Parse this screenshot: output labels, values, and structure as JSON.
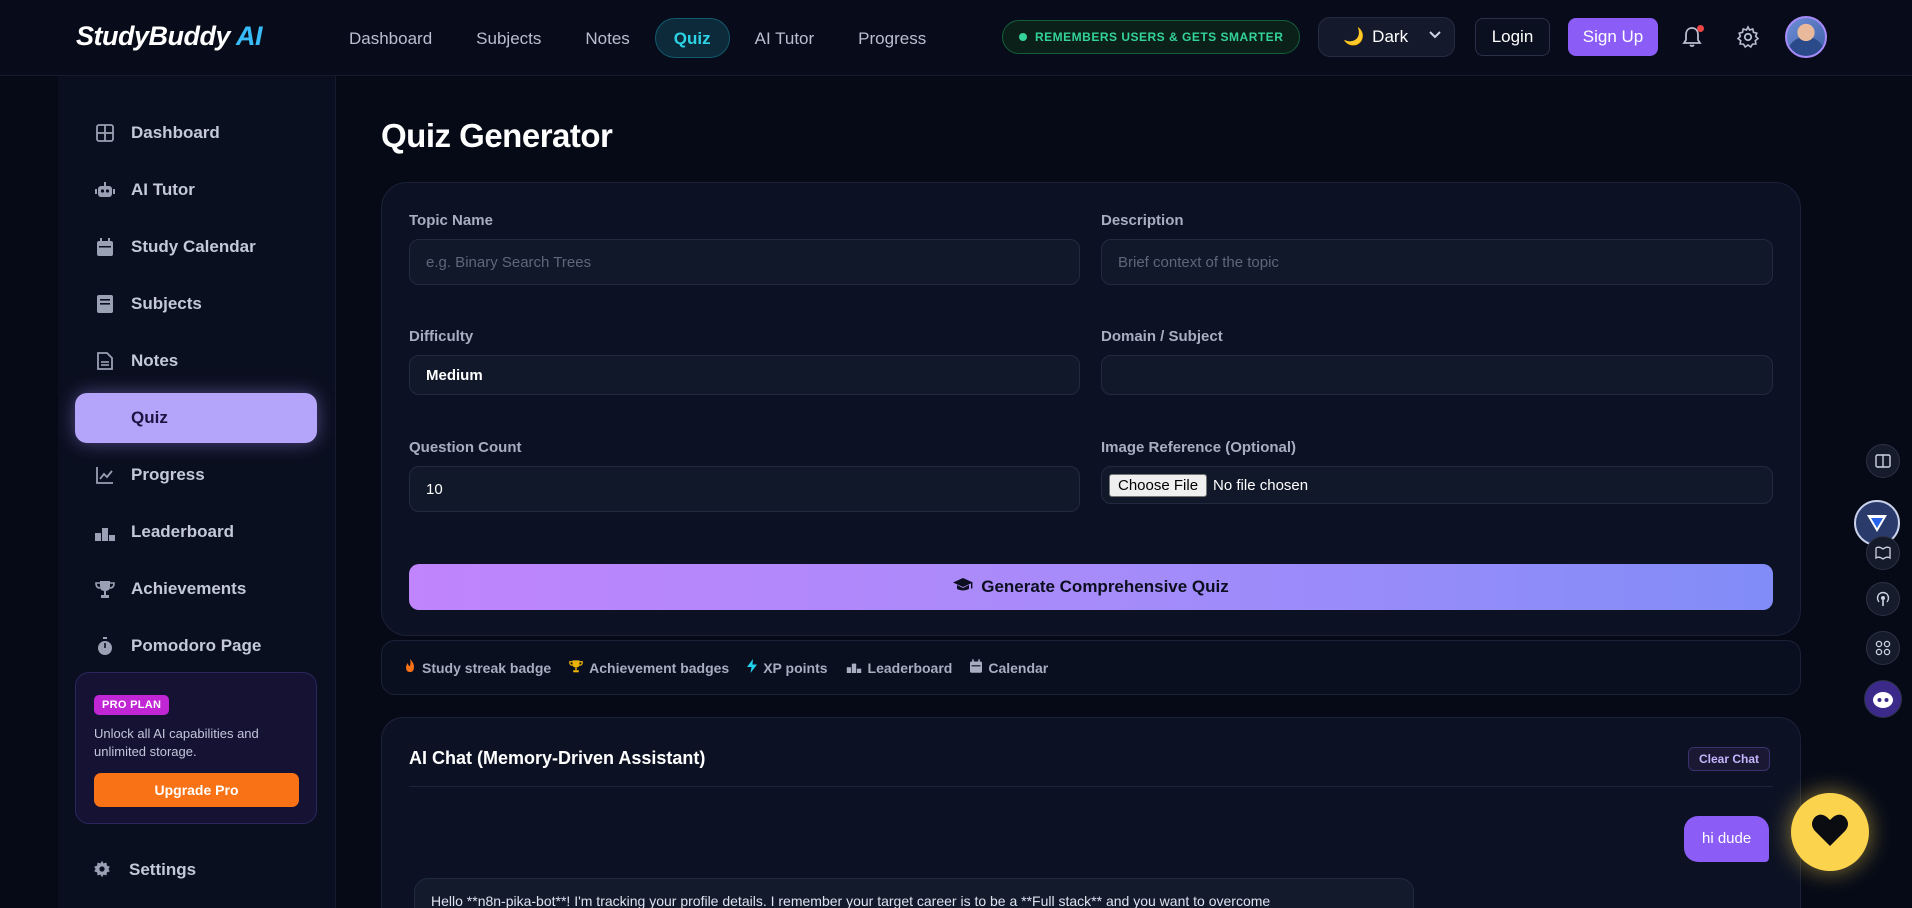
{
  "app": {
    "logo_main": "StudyBuddy",
    "logo_accent": "AI"
  },
  "topnav": {
    "links": [
      {
        "label": "Dashboard"
      },
      {
        "label": "Subjects"
      },
      {
        "label": "Notes"
      },
      {
        "label": "Quiz",
        "active": true
      },
      {
        "label": "AI Tutor"
      },
      {
        "label": "Progress"
      }
    ],
    "memory_badge": "REMEMBERS USERS & GETS SMARTER",
    "theme": {
      "icon": "moon-icon",
      "selected": "Dark"
    },
    "login": "Login",
    "signup": "Sign Up"
  },
  "sidebar": {
    "items": [
      {
        "label": "Dashboard",
        "icon": "dashboard-icon"
      },
      {
        "label": "AI Tutor",
        "icon": "robot-icon"
      },
      {
        "label": "Study Calendar",
        "icon": "calendar-icon"
      },
      {
        "label": "Subjects",
        "icon": "book-icon"
      },
      {
        "label": "Notes",
        "icon": "document-icon"
      },
      {
        "label": "Quiz",
        "icon": "",
        "active": true
      },
      {
        "label": "Progress",
        "icon": "chart-icon"
      },
      {
        "label": "Leaderboard",
        "icon": "podium-icon"
      },
      {
        "label": "Achievements",
        "icon": "trophy-icon"
      },
      {
        "label": "Pomodoro Page",
        "icon": "stopwatch-icon"
      }
    ],
    "pro": {
      "badge": "PRO PLAN",
      "text": "Unlock all AI capabilities and unlimited storage.",
      "button": "Upgrade Pro"
    },
    "settings": "Settings"
  },
  "main": {
    "title": "Quiz Generator",
    "form": {
      "topic": {
        "label": "Topic Name",
        "placeholder": "e.g. Binary Search Trees",
        "value": ""
      },
      "description": {
        "label": "Description",
        "placeholder": "Brief context of the topic",
        "value": ""
      },
      "difficulty": {
        "label": "Difficulty",
        "value": "Medium"
      },
      "domain": {
        "label": "Domain / Subject",
        "value": ""
      },
      "count": {
        "label": "Question Count",
        "value": "10"
      },
      "image": {
        "label": "Image Reference (Optional)",
        "button": "Choose File",
        "status": "No file chosen"
      },
      "generate": "Generate Comprehensive Quiz"
    },
    "badges": [
      {
        "label": "Study streak badge",
        "icon": "fire-icon",
        "color": "#f97316"
      },
      {
        "label": "Achievement badges",
        "icon": "trophy-icon",
        "color": "#eab308"
      },
      {
        "label": "XP points",
        "icon": "lightning-icon",
        "color": "#22d3ee"
      },
      {
        "label": "Leaderboard",
        "icon": "podium-icon",
        "color": "#a7aec0"
      },
      {
        "label": "Calendar",
        "icon": "calendar-icon",
        "color": "#a7aec0"
      }
    ],
    "chat": {
      "title": "AI Chat (Memory-Driven Assistant)",
      "clear": "Clear Chat",
      "user_message": "hi dude",
      "bot_message": "Hello **n8n-pika-bot**! I'm tracking your profile details. I remember your target career is to be a **Full stack** and you want to overcome"
    }
  },
  "colors": {
    "accent": "#8b5cf6",
    "active_sidebar": "#b4a5fb",
    "active_nav": "#2dd4e6",
    "memory_green": "#34d399",
    "upgrade_orange": "#f97316",
    "heart_fab": "#fcd34d"
  }
}
